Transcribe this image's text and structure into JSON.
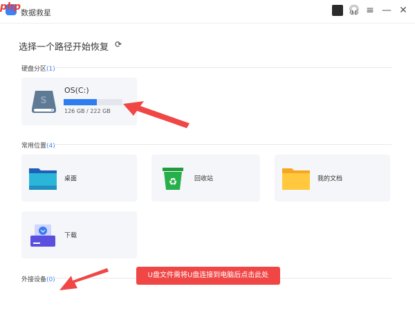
{
  "app": {
    "title": "数据救星",
    "watermark": "php中文网"
  },
  "main": {
    "heading": "选择一个路径开始恢复"
  },
  "sections": {
    "disk": {
      "label": "硬盘分区",
      "count": "(1)"
    },
    "common": {
      "label": "常用位置",
      "count": "(4)"
    },
    "external": {
      "label": "外接设备",
      "count": "(0)"
    }
  },
  "disk": {
    "name": "OS(C:)",
    "used_fraction": 0.567,
    "size": "126 GB / 222 GB"
  },
  "locations": [
    {
      "label": "桌面"
    },
    {
      "label": "回收站"
    },
    {
      "label": "我的文档"
    },
    {
      "label": "下载"
    }
  ],
  "tooltip": "U盘文件需将U盘连接到电脑后点击此处",
  "colors": {
    "accent": "#2f7cf0",
    "annotation": "#f04646"
  }
}
